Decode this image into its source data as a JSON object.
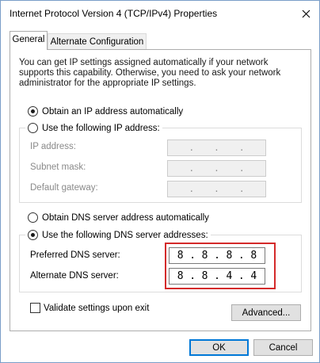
{
  "window": {
    "title": "Internet Protocol Version 4 (TCP/IPv4) Properties",
    "close_icon": "close-icon"
  },
  "tabs": [
    {
      "label": "General",
      "selected": true
    },
    {
      "label": "Alternate Configuration",
      "selected": false
    }
  ],
  "description": "You can get IP settings assigned automatically if your network supports this capability. Otherwise, you need to ask your network administrator for the appropriate IP settings.",
  "ip_section": {
    "auto_label": "Obtain an IP address automatically",
    "auto_selected": true,
    "manual_label": "Use the following IP address:",
    "manual_selected": false,
    "fields": [
      {
        "label": "IP address:",
        "octets": [
          "",
          "",
          "",
          ""
        ]
      },
      {
        "label": "Subnet mask:",
        "octets": [
          "",
          "",
          "",
          ""
        ]
      },
      {
        "label": "Default gateway:",
        "octets": [
          "",
          "",
          "",
          ""
        ]
      }
    ]
  },
  "dns_section": {
    "auto_label": "Obtain DNS server address automatically",
    "auto_selected": false,
    "manual_label": "Use the following DNS server addresses:",
    "manual_selected": true,
    "preferred": {
      "label": "Preferred DNS server:",
      "octets": [
        "8",
        "8",
        "8",
        "8"
      ]
    },
    "alternate": {
      "label": "Alternate DNS server:",
      "octets": [
        "8",
        "8",
        "4",
        "4"
      ]
    },
    "highlight_color": "#d42a2a"
  },
  "validate": {
    "label": "Validate settings upon exit",
    "checked": false
  },
  "buttons": {
    "advanced": "Advanced...",
    "ok": "OK",
    "cancel": "Cancel"
  },
  "colors": {
    "accent": "#0078d7",
    "highlight": "#d42a2a"
  }
}
